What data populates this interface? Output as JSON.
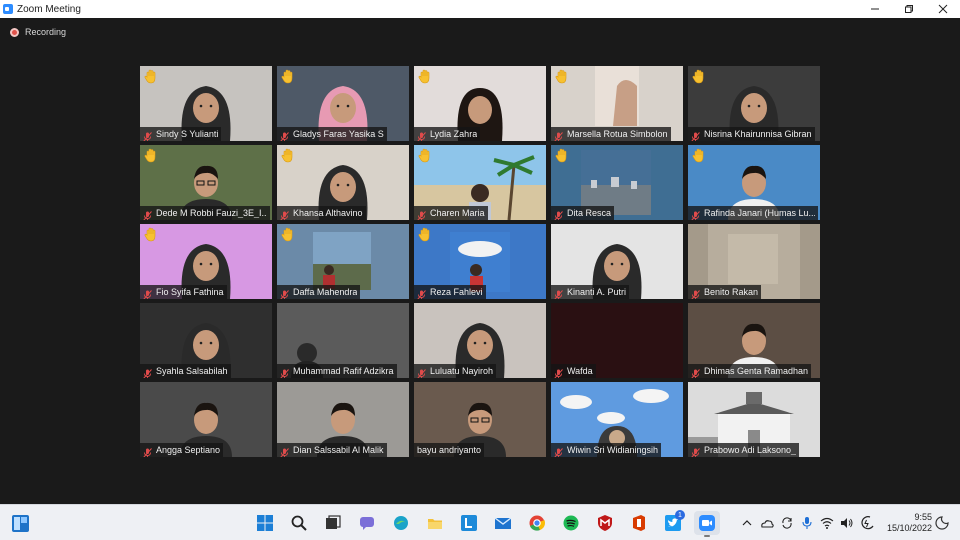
{
  "window": {
    "title": "Zoom Meeting",
    "controls": [
      "minimize",
      "maximize",
      "close"
    ]
  },
  "recording": {
    "label": "Recording"
  },
  "participants": [
    {
      "name": "Sindy S Yulianti",
      "hand_raised": true,
      "muted": true,
      "active": false,
      "bg": "#c6c3bf",
      "face": "hijab-dark"
    },
    {
      "name": "Gladys Faras Yasika S",
      "hand_raised": true,
      "muted": true,
      "active": false,
      "bg": "#4e5967",
      "face": "hijab-pink"
    },
    {
      "name": "Lydia Zahra",
      "hand_raised": true,
      "muted": true,
      "active": false,
      "bg": "#e2dcda",
      "face": "hair-dark"
    },
    {
      "name": "Marsella Rotua Simbolon",
      "hand_raised": true,
      "muted": true,
      "active": false,
      "bg": "#d8d2cb",
      "face": "partial"
    },
    {
      "name": "Nisrina Khairunnisa Gibran",
      "hand_raised": true,
      "muted": true,
      "active": false,
      "bg": "#3c3c3c",
      "face": "hijab-dark"
    },
    {
      "name": "Dede M Robbi Fauzi_3E_I...",
      "hand_raised": true,
      "muted": true,
      "active": false,
      "bg": "#5e7048",
      "face": "man-glasses"
    },
    {
      "name": "Khansa Althavino",
      "hand_raised": true,
      "muted": true,
      "active": false,
      "bg": "#d8d2c9",
      "face": "hijab-dark"
    },
    {
      "name": "Charen Maria",
      "hand_raised": true,
      "muted": true,
      "active": false,
      "bg": "#6aa9d4",
      "face": "beach"
    },
    {
      "name": "Dita Resca",
      "hand_raised": true,
      "muted": true,
      "active": false,
      "bg": "#3f6e93",
      "face": "city"
    },
    {
      "name": "Rafinda Janari (Humas Lu...",
      "hand_raised": true,
      "muted": true,
      "active": false,
      "bg": "#4a8ac6",
      "face": "man-shirt"
    },
    {
      "name": "Fio Syifa Fathina",
      "hand_raised": true,
      "muted": true,
      "active": false,
      "bg": "#d798e3",
      "face": "hijab-dark"
    },
    {
      "name": "Daffa Mahendra",
      "hand_raised": true,
      "muted": true,
      "active": false,
      "bg": "#6b8aa8",
      "face": "outdoor"
    },
    {
      "name": "Reza Fahlevi",
      "hand_raised": true,
      "muted": true,
      "active": false,
      "bg": "#3d78c7",
      "face": "sky"
    },
    {
      "name": "Kinanti A. Putri",
      "hand_raised": false,
      "muted": true,
      "active": false,
      "bg": "#e4e4e4",
      "face": "hijab-dark"
    },
    {
      "name": "Benito Rakan",
      "hand_raised": false,
      "muted": true,
      "active": false,
      "bg": "#a49a8a",
      "face": "blur"
    },
    {
      "name": "Syahla Salsabilah",
      "hand_raised": false,
      "muted": true,
      "active": false,
      "bg": "#2f2f2f",
      "face": "hijab-dark"
    },
    {
      "name": "Muhammad Rafif Adzikra",
      "hand_raised": false,
      "muted": true,
      "active": false,
      "bg": "#6e6e6e",
      "face": "dark"
    },
    {
      "name": "Luluatu Nayiroh",
      "hand_raised": false,
      "muted": true,
      "active": false,
      "bg": "#c9c3be",
      "face": "hijab-dark"
    },
    {
      "name": "Wafda",
      "hand_raised": false,
      "muted": true,
      "active": false,
      "bg": "#2a1012",
      "face": "none"
    },
    {
      "name": "Dhimas Genta Ramadhan",
      "hand_raised": false,
      "muted": true,
      "active": false,
      "bg": "#5c4e44",
      "face": "man-shirt"
    },
    {
      "name": "Angga Septiano",
      "hand_raised": false,
      "muted": true,
      "active": false,
      "bg": "#4a4a4a",
      "face": "man-dark"
    },
    {
      "name": "Dian Salssabil Al Malik",
      "hand_raised": false,
      "muted": true,
      "active": false,
      "bg": "#9c9a96",
      "face": "man-dark"
    },
    {
      "name": "bayu andriyanto",
      "hand_raised": false,
      "muted": false,
      "active": true,
      "bg": "#6a5a4e",
      "face": "man-glasses"
    },
    {
      "name": "Wiwin Sri Widianingsih",
      "hand_raised": false,
      "muted": true,
      "active": false,
      "bg": "#5f9be0",
      "face": "clouds"
    },
    {
      "name": "Prabowo Adi Laksono_",
      "hand_raised": false,
      "muted": true,
      "active": false,
      "bg": "#d6d6d6",
      "face": "building"
    }
  ],
  "taskbar": {
    "apps": [
      {
        "name": "start-icon"
      },
      {
        "name": "search-icon"
      },
      {
        "name": "task-view-icon"
      },
      {
        "name": "chat-icon"
      },
      {
        "name": "edge-icon"
      },
      {
        "name": "file-explorer-icon"
      },
      {
        "name": "l-app-icon"
      },
      {
        "name": "mail-icon"
      },
      {
        "name": "chrome-icon"
      },
      {
        "name": "spotify-icon"
      },
      {
        "name": "mcafee-icon"
      },
      {
        "name": "office-icon"
      },
      {
        "name": "twitter-icon",
        "badge": "1"
      },
      {
        "name": "zoom-icon",
        "active": true
      }
    ],
    "tray": [
      "chevron-up-icon",
      "onedrive-icon",
      "sync-icon",
      "microphone-icon",
      "wifi-icon",
      "volume-icon",
      "battery-icon"
    ],
    "time": "9:55",
    "date": "15/10/2022"
  }
}
